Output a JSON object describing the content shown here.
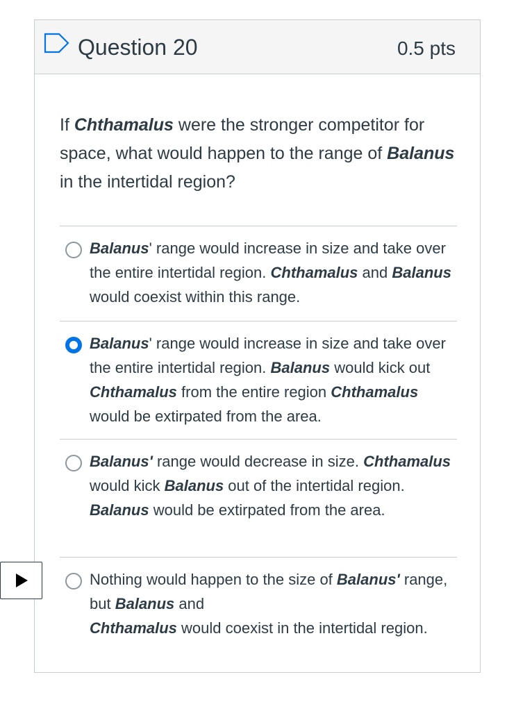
{
  "question": {
    "title": "Question 20",
    "points": "0.5 pts",
    "flag_icon": "flag-outline-icon",
    "text_parts": {
      "p1": "If ",
      "b1": "Chthamalus",
      "p2": " were the stronger competitor for space, what would happen to the range of ",
      "b2": "Balanus",
      "p3": " in the intertidal region?"
    }
  },
  "answers": [
    {
      "selected": false,
      "parts": {
        "b1": "Balanus",
        "p1": "' range would increase in size and take over the entire intertidal region.  ",
        "b2": "Chthamalus",
        "p2": " and ",
        "b3": "Balanus",
        "p3": " would coexist within this range."
      }
    },
    {
      "selected": true,
      "parts": {
        "b1": "Balanus",
        "p1": "' range would increase in size and take over the entire intertidal region.  ",
        "b2": "Balanus",
        "p2": " would kick out ",
        "b3": "Chthamalus",
        "p3": " from the entire region ",
        "b4": "Chthamalus",
        "p4": " would be extirpated from the area."
      }
    },
    {
      "selected": false,
      "parts": {
        "b1": "Balanus'",
        "p1": " range would decrease in size. ",
        "b2": "Chthamalus",
        "p2": " would kick ",
        "b3": "Balanus",
        "p3": " out of the intertidal region.  ",
        "b4": "Balanus",
        "p4": " would be extirpated from the area."
      }
    },
    {
      "selected": false,
      "parts": {
        "p1": "Nothing would happen to the size of ",
        "b1": "Balanus'",
        "p2": " range, but ",
        "b2": "Balanus",
        "p3": " and ",
        "b3": "Chthamalus",
        "p4": " would coexist in the intertidal region."
      }
    }
  ],
  "media": {
    "play_icon": "play-icon"
  },
  "colors": {
    "selected_radio": "#0374e5",
    "text": "#2d3b45",
    "header_bg": "#f5f5f5",
    "border": "#c7cdd1"
  }
}
